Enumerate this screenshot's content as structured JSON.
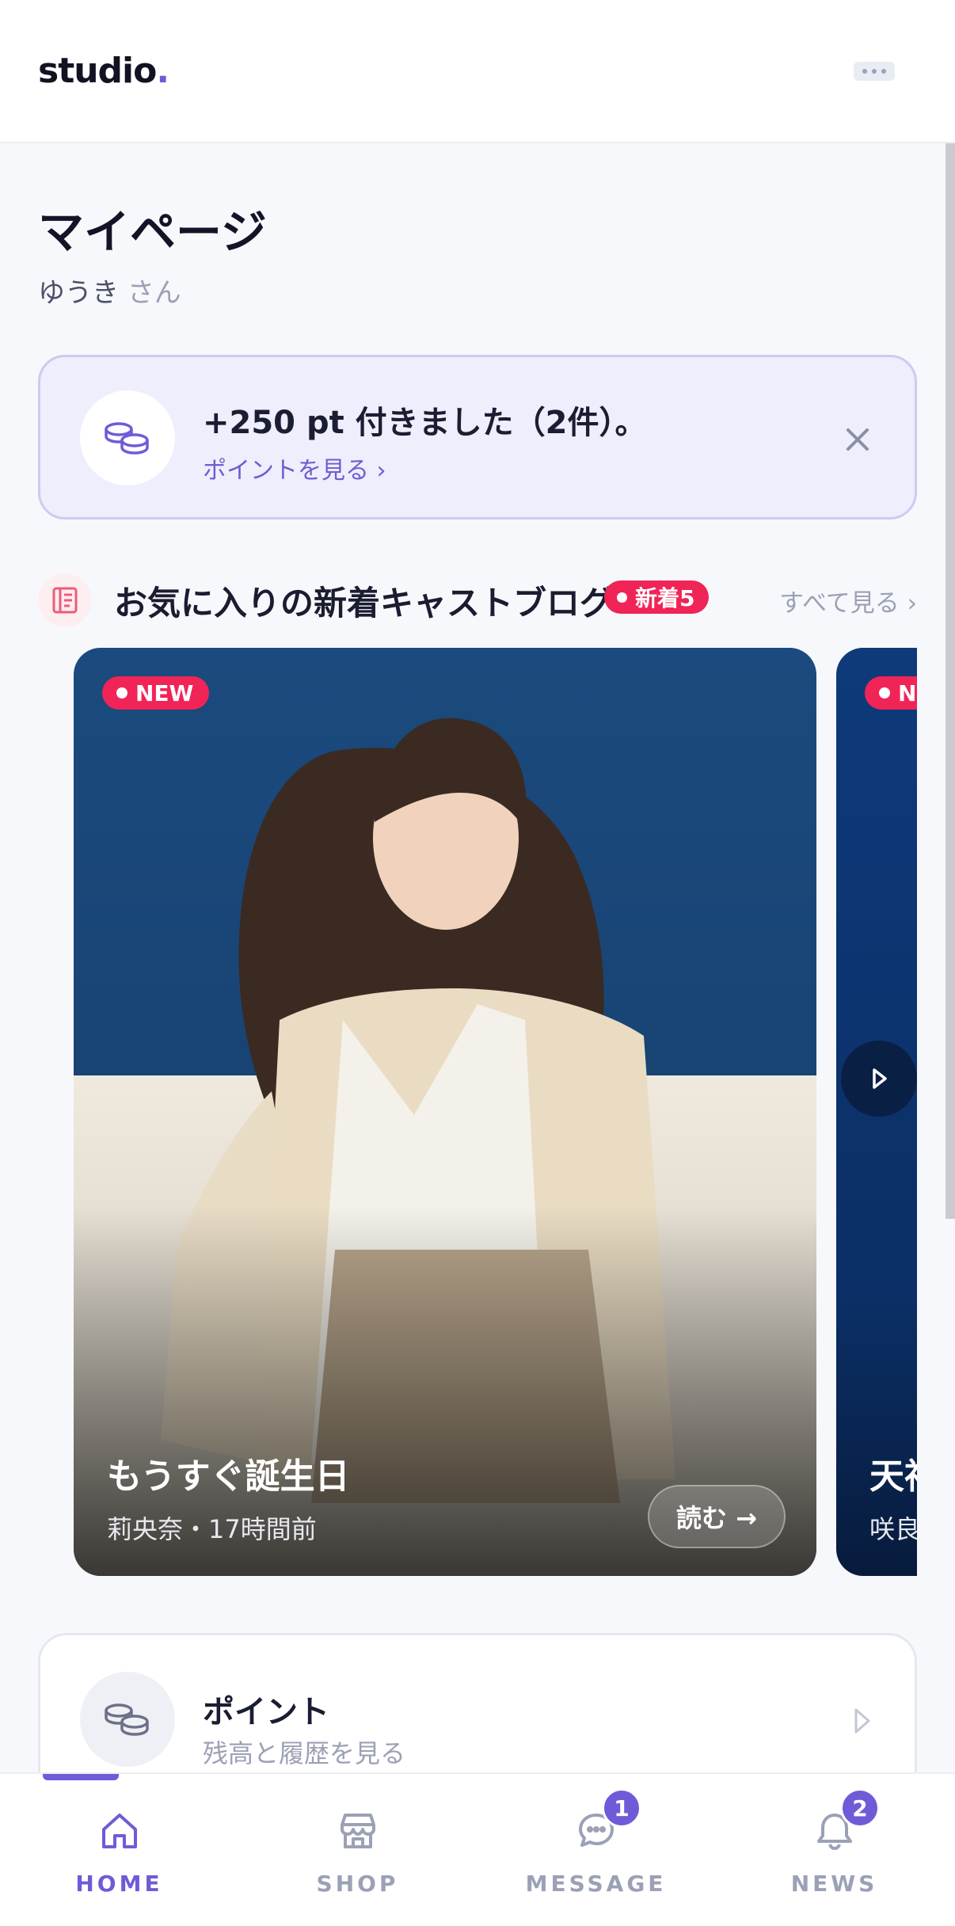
{
  "header": {
    "logo_text": "studio",
    "logo_dot": "."
  },
  "page": {
    "title": "マイページ",
    "user_name": "ゆうき",
    "user_suffix": "さん"
  },
  "notice": {
    "title": "+250 pt 付きました（2件）。",
    "link": "ポイントを見る ›"
  },
  "blog_section": {
    "title": "お気に入りの新着キャストブログ",
    "new_badge": "新着5",
    "see_all": "すべて見る ›",
    "cards": [
      {
        "badge": "NEW",
        "title": "もうすぐ誕生日",
        "meta": "莉央奈・17時間前",
        "read_label": "読む →"
      },
      {
        "badge": "N",
        "title": "天神",
        "meta": "咲良"
      }
    ]
  },
  "point_card": {
    "title": "ポイント",
    "subtitle": "残高と履歴を見る"
  },
  "tabs": [
    {
      "label": "HOME",
      "icon": "home-icon",
      "active": true
    },
    {
      "label": "SHOP",
      "icon": "shop-icon",
      "active": false
    },
    {
      "label": "MESSAGE",
      "icon": "message-icon",
      "active": false,
      "badge": "1"
    },
    {
      "label": "NEWS",
      "icon": "bell-icon",
      "active": false,
      "badge": "2"
    }
  ],
  "colors": {
    "accent": "#6f5bd8",
    "new_badge": "#f02457",
    "notice_bg": "#eeeefc"
  }
}
